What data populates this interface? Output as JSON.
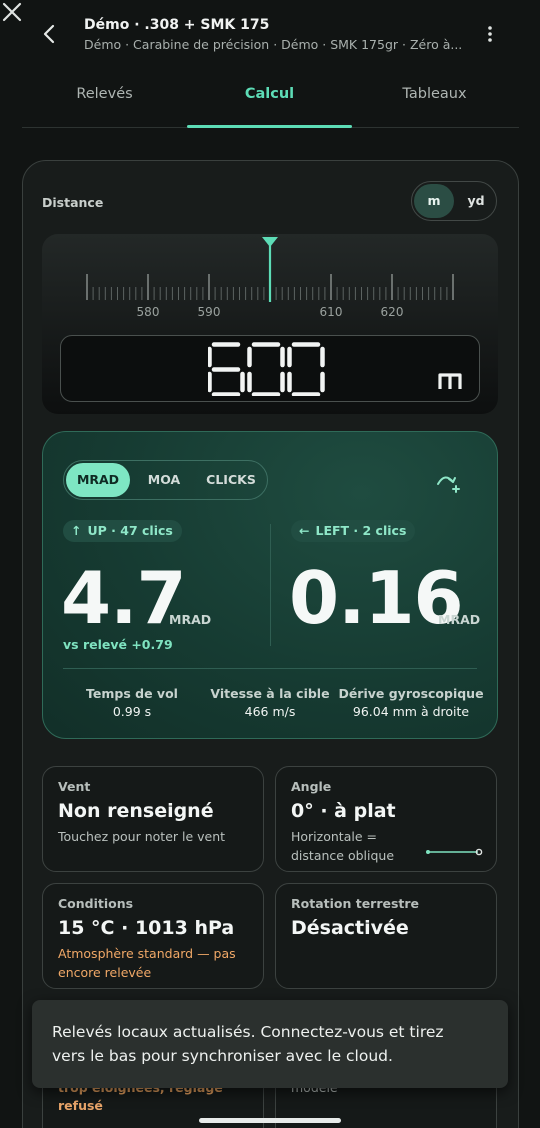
{
  "header": {
    "title": "Démo · .308 + SMK 175",
    "subtitle": "Démo · Carabine de précision · Démo · SMK 175gr · Zéro à..."
  },
  "tabs": [
    {
      "label": "Relevés"
    },
    {
      "label": "Calcul"
    },
    {
      "label": "Tableaux"
    }
  ],
  "distance": {
    "label": "Distance",
    "units": [
      "m",
      "yd"
    ],
    "selected_unit": "m",
    "ruler_labels": [
      "580",
      "590",
      "610",
      "620"
    ],
    "value": "600",
    "unit_display": "m"
  },
  "result": {
    "modes": [
      "MRAD",
      "MOA",
      "CLICKS"
    ],
    "selected_mode": "MRAD",
    "elevation": {
      "chip": "UP · 47 clics",
      "value": "4.7",
      "unit": "MRAD",
      "delta": "vs relevé +0.79"
    },
    "windage": {
      "chip": "LEFT · 2 clics",
      "value": "0.16",
      "unit": "MRAD"
    },
    "stats": [
      {
        "label": "Temps de vol",
        "value": "0.99 s"
      },
      {
        "label": "Vitesse à la cible",
        "value": "466 m/s"
      },
      {
        "label": "Dérive gyroscopique",
        "value": "96.04 mm à droite"
      }
    ]
  },
  "tiles": {
    "wind": {
      "title": "Vent",
      "value": "Non renseigné",
      "sub": "Touchez pour noter le vent"
    },
    "angle": {
      "title": "Angle",
      "value": "0° · à plat",
      "sub1": "Horizontale =",
      "sub2": "distance oblique"
    },
    "conditions": {
      "title": "Conditions",
      "value": "15 °C · 1013 hPa",
      "sub1": "Atmosphère standard — pas",
      "sub2": "encore relevée"
    },
    "rotation": {
      "title": "Rotation terrestre",
      "value": "Désactivée"
    },
    "hidden_left_1": "trop éloignées, réglage",
    "hidden_left_2": "refusé",
    "hidden_right": "modèle"
  },
  "snackbar": {
    "message": "Relevés locaux actualisés. Connectez-vous et tirez vers le bas pour synchroniser avec le cloud."
  },
  "colors": {
    "accent": "#5ddcb6",
    "warning": "#f0a867",
    "result_bg": "#163b32"
  }
}
